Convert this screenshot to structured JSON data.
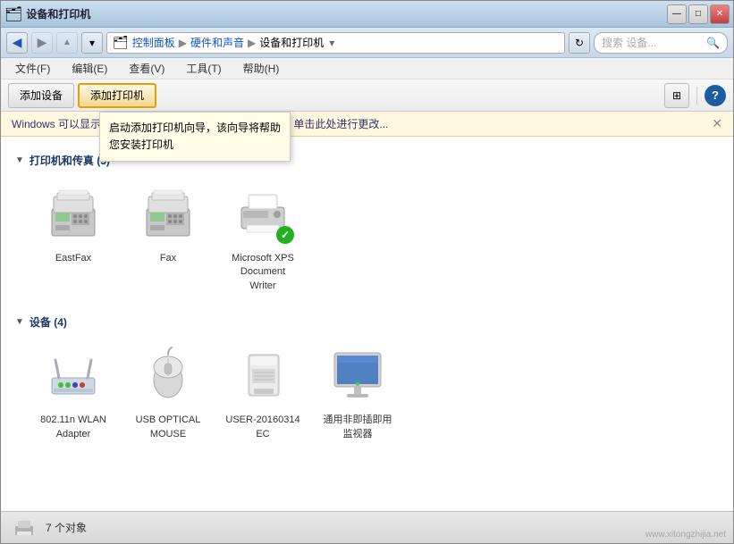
{
  "window": {
    "title": "设备和打印机"
  },
  "titlebar": {
    "minimize_label": "—",
    "maximize_label": "□",
    "close_label": "✕"
  },
  "nav": {
    "back_icon": "◀",
    "forward_icon": "▶",
    "up_icon": "▲",
    "breadcrumb": [
      "控制面板",
      "硬件和声音",
      "设备和打印机"
    ],
    "search_placeholder": "搜索 设备...",
    "refresh_icon": "↻",
    "dropdown_icon": "▼"
  },
  "menubar": {
    "items": [
      "文件(F)",
      "编辑(E)",
      "查看(V)",
      "工具(T)",
      "帮助(H)"
    ]
  },
  "toolbar": {
    "add_device_label": "添加设备",
    "add_printer_label": "添加打印机",
    "view_icon": "≡",
    "help_label": "?"
  },
  "tooltip": {
    "line1": "启动添加打印机向导，该向导将帮助",
    "line2": "您安装打印机"
  },
  "infobar": {
    "text": "Windows 可以显示增强型设备图标和来自 Internet 的信息。单击此处进行更改...",
    "close_icon": "✕"
  },
  "printers_section": {
    "title": "打印机和传真 (3)",
    "items": [
      {
        "name": "EastFax",
        "type": "fax"
      },
      {
        "name": "Fax",
        "type": "fax2"
      },
      {
        "name": "Microsoft XPS\nDocument\nWriter",
        "type": "printer",
        "default": true
      }
    ]
  },
  "devices_section": {
    "title": "设备 (4)",
    "items": [
      {
        "name": "802.11n WLAN\nAdapter",
        "type": "router"
      },
      {
        "name": "USB OPTICAL\nMOUSE",
        "type": "mouse"
      },
      {
        "name": "USER-20160314\nEC",
        "type": "hdd"
      },
      {
        "name": "通用非即插即用\n监视器",
        "type": "monitor"
      }
    ]
  },
  "statusbar": {
    "count": "7 个对象"
  },
  "watermark": "www.xitongzhijia.net"
}
